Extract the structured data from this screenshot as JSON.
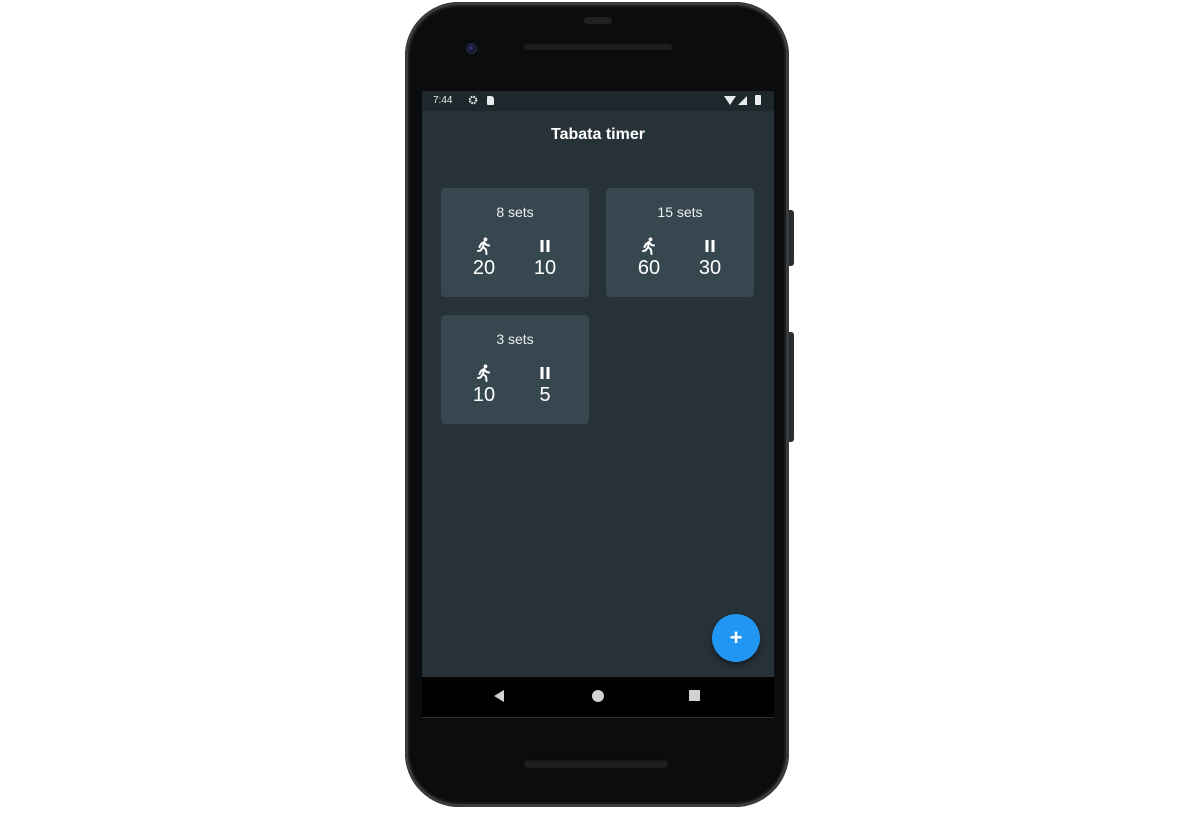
{
  "status_bar": {
    "time": "7:44",
    "icons": [
      "settings-icon",
      "sd-card-icon",
      "wifi-icon",
      "signal-icon",
      "battery-icon"
    ]
  },
  "app": {
    "title": "Tabata timer",
    "colors": {
      "background": "#263238",
      "card": "#37474f",
      "fab": "#2196f3",
      "text": "#ffffff"
    }
  },
  "workouts": [
    {
      "sets_label": "8 sets",
      "work_seconds": "20",
      "rest_seconds": "10"
    },
    {
      "sets_label": "15 sets",
      "work_seconds": "60",
      "rest_seconds": "30"
    },
    {
      "sets_label": "3 sets",
      "work_seconds": "10",
      "rest_seconds": "5"
    }
  ],
  "fab": {
    "icon": "add-icon",
    "glyph": "+"
  },
  "nav_bar": {
    "icons": [
      "back-icon",
      "home-icon",
      "recents-icon"
    ]
  }
}
